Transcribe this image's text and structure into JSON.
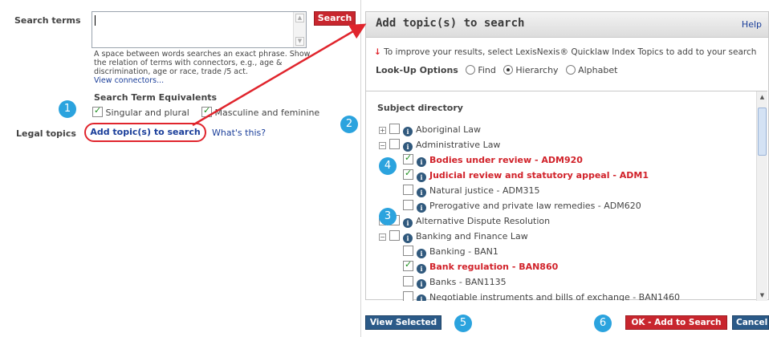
{
  "search": {
    "label": "Search terms",
    "button": "Search",
    "help_text": "A space between words searches an exact phrase. Show the relation of terms with connectors, e.g., age & discrimination, age or race, trade /5 act.",
    "view_connectors": "View connectors..."
  },
  "equivalents": {
    "heading": "Search Term Equivalents",
    "singular": "Singular and plural",
    "masculine": "Masculine and feminine"
  },
  "legal_topics": {
    "label": "Legal topics",
    "add_link": "Add topic(s) to search",
    "whats_this": "What's this?"
  },
  "dialog": {
    "title": "Add topic(s) to search",
    "help": "Help",
    "improve_arrow": "↓",
    "improve": "To improve your results, select LexisNexis® Quicklaw Index Topics to add to your search",
    "lookup_label": "Look-Up Options",
    "options": [
      "Find",
      "Hierarchy",
      "Alphabet"
    ],
    "selected_option": "Hierarchy",
    "subject_heading": "Subject directory",
    "tree": [
      {
        "label": "Aboriginal Law",
        "level": 0,
        "expander": "+",
        "checked": false,
        "selected": false
      },
      {
        "label": "Administrative Law",
        "level": 0,
        "expander": "−",
        "checked": false,
        "selected": false
      },
      {
        "label": "Bodies under review - ADM920",
        "level": 1,
        "expander": "",
        "checked": true,
        "selected": true
      },
      {
        "label": "Judicial review and statutory appeal - ADM1",
        "level": 1,
        "expander": "",
        "checked": true,
        "selected": true
      },
      {
        "label": "Natural justice - ADM315",
        "level": 1,
        "expander": "",
        "checked": false,
        "selected": false
      },
      {
        "label": "Prerogative and private law remedies - ADM620",
        "level": 1,
        "expander": "",
        "checked": false,
        "selected": false
      },
      {
        "label": "Alternative Dispute Resolution",
        "level": 0,
        "expander": "+",
        "checked": false,
        "selected": false
      },
      {
        "label": "Banking and Finance Law",
        "level": 0,
        "expander": "−",
        "checked": false,
        "selected": false
      },
      {
        "label": "Banking - BAN1",
        "level": 1,
        "expander": "",
        "checked": false,
        "selected": false
      },
      {
        "label": "Bank regulation - BAN860",
        "level": 1,
        "expander": "",
        "checked": true,
        "selected": true
      },
      {
        "label": "Banks - BAN1135",
        "level": 1,
        "expander": "",
        "checked": false,
        "selected": false
      },
      {
        "label": "Negotiable instruments and bills of exchange - BAN1460",
        "level": 1,
        "expander": "",
        "checked": false,
        "selected": false
      }
    ]
  },
  "buttons": {
    "view_selected": "View Selected",
    "ok": "OK - Add to Search",
    "cancel": "Cancel"
  },
  "badges": [
    "1",
    "2",
    "3",
    "4",
    "5",
    "6"
  ],
  "colors": {
    "accent_red": "#c8262e",
    "badge_blue": "#2ba3de",
    "link_blue": "#1a3e9a",
    "button_blue": "#2b5a88"
  }
}
